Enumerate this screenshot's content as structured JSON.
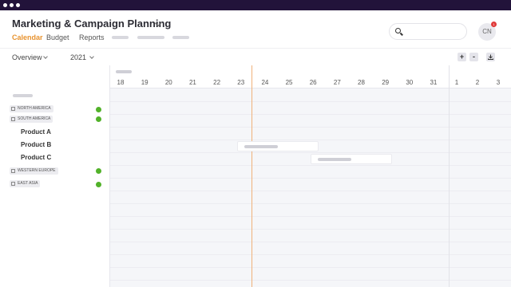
{
  "app": {
    "title": "Marketing & Campaign Planning"
  },
  "tabs": [
    {
      "label": "Calendar",
      "active": true
    },
    {
      "label": "Budget",
      "active": false
    },
    {
      "label": "Reports",
      "active": false
    }
  ],
  "search": {
    "placeholder": ""
  },
  "user": {
    "initials": "CN",
    "notification_count": "1"
  },
  "toolbar": {
    "view": "Overview",
    "year": "2021",
    "zoom_in": "+",
    "zoom_out": "-"
  },
  "timeline": {
    "dates": [
      "18",
      "19",
      "20",
      "21",
      "22",
      "23",
      "24",
      "25",
      "26",
      "27",
      "28",
      "29",
      "30",
      "31",
      "1",
      "2",
      "3"
    ]
  },
  "regions": [
    {
      "label": "NORTH AMERICA",
      "status": "green"
    },
    {
      "label": "SOUTH AMERICA",
      "status": "green"
    },
    {
      "label": "WESTERN EUROPE",
      "status": "green"
    },
    {
      "label": "EAST ASIA",
      "status": "green"
    }
  ],
  "products": [
    "Product A",
    "Product B",
    "Product C"
  ],
  "colors": {
    "accent": "#e8932f",
    "status_green": "#52b22a",
    "titlebar": "#22133a",
    "today_line": "#f0b27a",
    "notification": "#e03a3a"
  }
}
